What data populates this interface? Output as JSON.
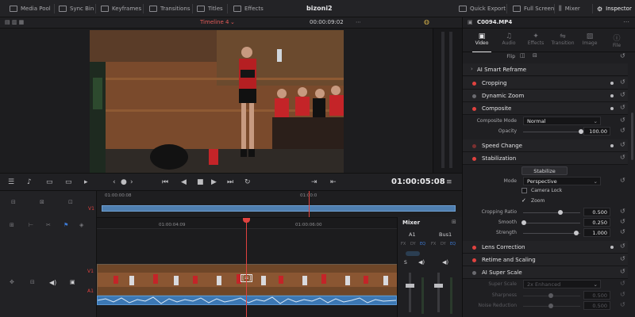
{
  "topbar": {
    "media_pool": "Media Pool",
    "sync_bin": "Sync Bin",
    "keyframes": "Keyframes",
    "transitions": "Transitions",
    "titles": "Titles",
    "effects": "Effects",
    "project_title": "bizoni2",
    "quick_export": "Quick Export",
    "full_screen": "Full Screen",
    "mixer": "Mixer",
    "inspector": "Inspector"
  },
  "viewer": {
    "timeline_name": "Timeline 4",
    "timecode_top": "00:00:09:02",
    "timecode_main": "01:00:05:08"
  },
  "mini_timeline": {
    "ruler": [
      "01:00:00:08",
      "01:00:0"
    ],
    "track": "V1"
  },
  "main_timeline": {
    "ruler": [
      "01:00:04:09",
      "01:00:06:00"
    ],
    "tracks": [
      "V1",
      "A1"
    ]
  },
  "mixer": {
    "title": "Mixer",
    "channels": [
      "A1",
      "Bus1"
    ],
    "row_labels": [
      "FX",
      "DY",
      "EQ",
      "FX",
      "DY",
      "EQ"
    ]
  },
  "inspector": {
    "clip_name": "C0094.MP4",
    "tabs": [
      {
        "label": "Video",
        "glyph": "▣",
        "active": true
      },
      {
        "label": "Audio",
        "glyph": "♫",
        "active": false
      },
      {
        "label": "Effects",
        "glyph": "✦",
        "active": false
      },
      {
        "label": "Transition",
        "glyph": "⇋",
        "active": false
      },
      {
        "label": "Image",
        "glyph": "▨",
        "active": false
      },
      {
        "label": "File",
        "glyph": "ⓘ",
        "active": false
      }
    ],
    "flip_label": "Flip",
    "ai_smart_reframe": "AI Smart Reframe",
    "cropping": "Cropping",
    "dynamic_zoom": "Dynamic Zoom",
    "composite": "Composite",
    "composite_mode_label": "Composite Mode",
    "composite_mode_value": "Normal",
    "opacity_label": "Opacity",
    "opacity_value": "100.00",
    "speed_change": "Speed Change",
    "stabilization": "Stabilization",
    "stabilize_button": "Stabilize",
    "mode_label": "Mode",
    "mode_value": "Perspective",
    "camera_lock": "Camera Lock",
    "zoom": "Zoom",
    "cropping_ratio_label": "Cropping Ratio",
    "cropping_ratio_value": "0.500",
    "smooth_label": "Smooth",
    "smooth_value": "0.250",
    "strength_label": "Strength",
    "strength_value": "1.000",
    "lens_correction": "Lens Correction",
    "retime_scaling": "Retime and Scaling",
    "ai_super_scale": "AI Super Scale",
    "super_scale_label": "Super Scale",
    "super_scale_value": "2x Enhanced",
    "sharpness_label": "Sharpness",
    "sharpness_value": "0.500",
    "noise_reduction_label": "Noise Reduction",
    "noise_reduction_value": "0.500"
  },
  "colors": {
    "accent_red": "#e0423f",
    "clip_blue": "#4f7fb0",
    "audio_blue": "#3c78b4"
  }
}
